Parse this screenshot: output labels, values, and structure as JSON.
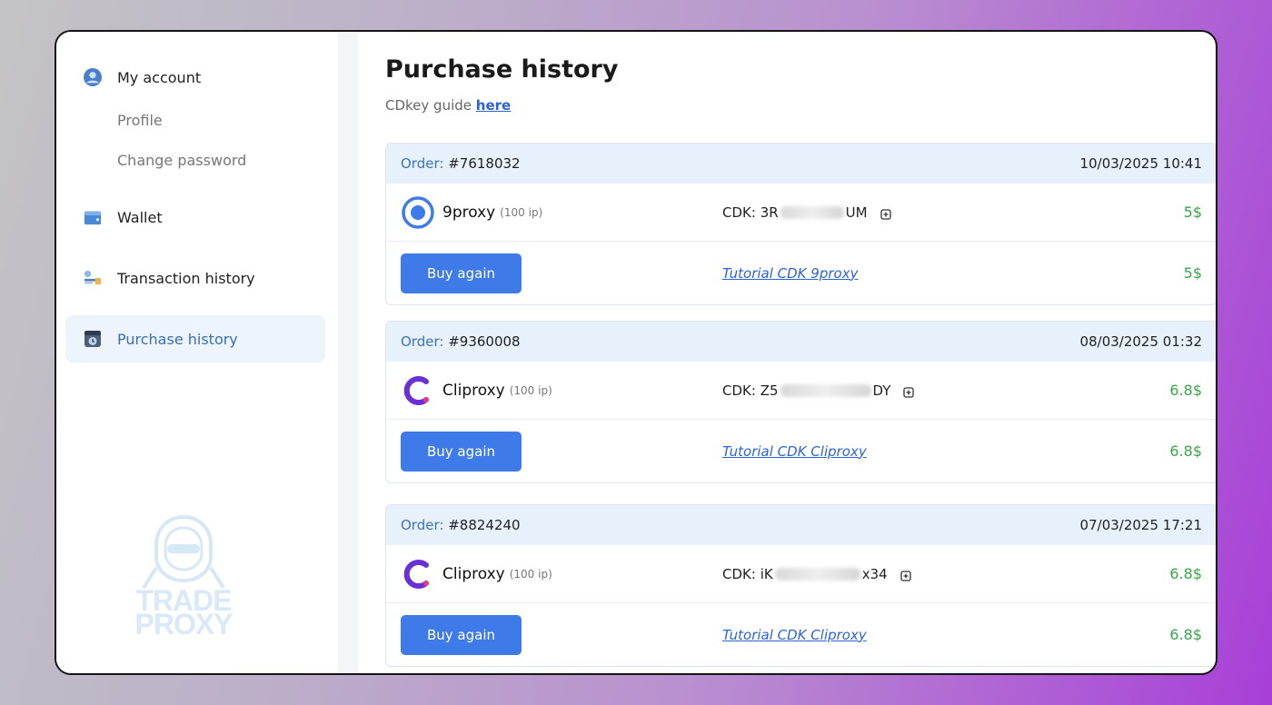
{
  "sidebar": {
    "account": {
      "label": "My account",
      "icon": "user-icon"
    },
    "sub_items": [
      "Profile",
      "Change password"
    ],
    "wallet": {
      "label": "Wallet",
      "icon": "wallet-icon"
    },
    "transactions": {
      "label": "Transaction history",
      "icon": "transaction-icon"
    },
    "purchases": {
      "label": "Purchase history",
      "icon": "history-icon"
    },
    "logo": {
      "line1": "TRADE",
      "line2": "PROXY"
    }
  },
  "main": {
    "title": "Purchase history",
    "guide_text": "CDkey guide",
    "guide_link": "here"
  },
  "orders": [
    {
      "order_label": "Order:",
      "order_id": "#7618032",
      "datetime": "10/03/2025 10:41",
      "product": "9proxy",
      "ip": "(100 ip)",
      "cdk_label": "CDK:",
      "cdk_start": "3R",
      "cdk_end": "UM",
      "price": "5$",
      "buy_label": "Buy again",
      "tutorial": "Tutorial CDK 9proxy",
      "total": "5$"
    },
    {
      "order_label": "Order:",
      "order_id": "#9360008",
      "datetime": "08/03/2025 01:32",
      "product": "Cliproxy",
      "ip": "(100 ip)",
      "cdk_label": "CDK:",
      "cdk_start": "Z5",
      "cdk_end": "DY",
      "price": "6.8$",
      "buy_label": "Buy again",
      "tutorial": "Tutorial CDK Cliproxy",
      "total": "6.8$"
    },
    {
      "order_label": "Order:",
      "order_id": "#8824240",
      "datetime": "07/03/2025 17:21",
      "product": "Cliproxy",
      "ip": "(100 ip)",
      "cdk_label": "CDK:",
      "cdk_start": "iK",
      "cdk_end": "x34",
      "price": "6.8$",
      "buy_label": "Buy again",
      "tutorial": "Tutorial CDK Cliproxy",
      "total": "6.8$"
    }
  ],
  "colors": {
    "accent": "#3f7be8",
    "price": "#3aa64a",
    "header_bg": "#e6f1fc",
    "active_bg": "#eef4fc"
  }
}
